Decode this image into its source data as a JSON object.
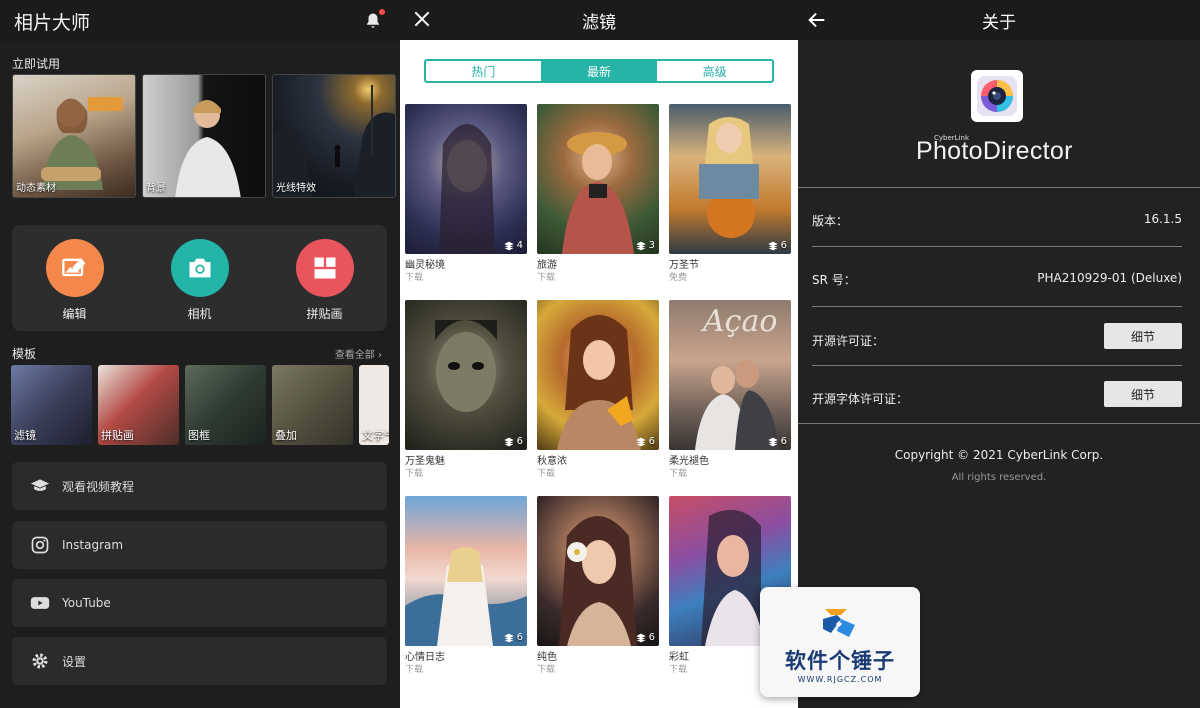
{
  "home": {
    "title": "相片大师",
    "try_label": "立即试用",
    "try_cards": [
      "动态素材",
      "背景",
      "光线特效"
    ],
    "tools": [
      {
        "label": "编辑",
        "color": "#f4884a"
      },
      {
        "label": "相机",
        "color": "#22b5a8"
      },
      {
        "label": "拼贴画",
        "color": "#e9555c"
      }
    ],
    "templates_label": "模板",
    "view_all": "查看全部",
    "templates": [
      "滤镜",
      "拼贴画",
      "图框",
      "叠加",
      "文字气泡"
    ],
    "menu": [
      "观看视频教程",
      "Instagram",
      "YouTube",
      "设置"
    ]
  },
  "filters": {
    "title": "滤镜",
    "tabs": [
      "热门",
      "最新",
      "高级"
    ],
    "active_tab": "最新",
    "accent": "#25b4a6",
    "items": [
      {
        "name": "幽灵秘境",
        "sub": "下载",
        "count": "4"
      },
      {
        "name": "旅游",
        "sub": "下载",
        "count": "3"
      },
      {
        "name": "万圣节",
        "sub": "免费",
        "count": "6"
      },
      {
        "name": "万圣鬼魅",
        "sub": "下载",
        "count": "6"
      },
      {
        "name": "秋意浓",
        "sub": "下载",
        "count": "6"
      },
      {
        "name": "柔光褪色",
        "sub": "下载",
        "count": "6"
      },
      {
        "name": "心情日志",
        "sub": "下载",
        "count": "6"
      },
      {
        "name": "纯色",
        "sub": "下载",
        "count": "6"
      },
      {
        "name": "彩虹",
        "sub": "下载",
        "count": ""
      }
    ],
    "photo_overlay_text": "Açao"
  },
  "about": {
    "title": "关于",
    "brand_small": "CyberLink",
    "brand": "PhotoDirector",
    "version_label": "版本：",
    "version_value": "16.1.5",
    "sr_label": "SR 号：",
    "sr_value": "PHA210929-01 (Deluxe)",
    "license_label": "开源许可证：",
    "font_license_label": "开源字体许可证：",
    "detail_button": "细节",
    "copyright": "Copyright © 2021 CyberLink Corp.",
    "rights": "All rights reserved."
  },
  "watermark": {
    "text": "软件个锤子",
    "url": "WWW.RJGCZ.COM"
  }
}
